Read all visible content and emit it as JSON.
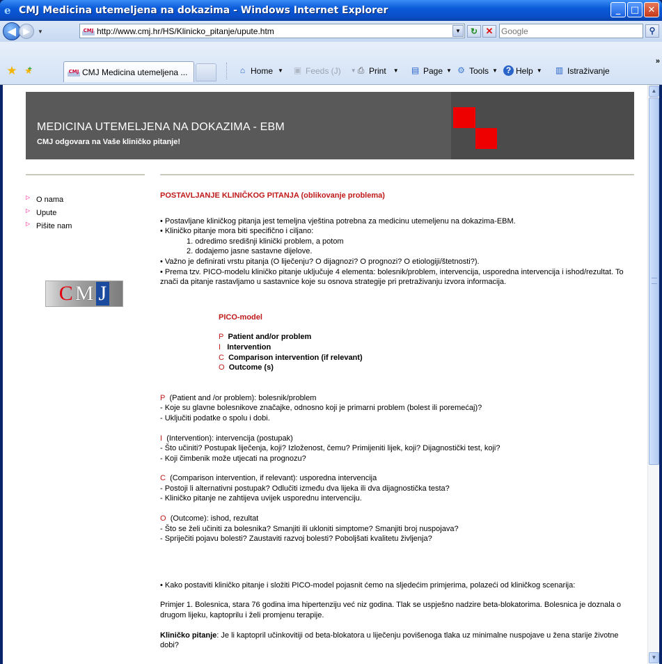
{
  "window": {
    "title": "CMJ Medicina utemeljena na dokazima - Windows Internet Explorer"
  },
  "addressbar": {
    "url": "http://www.cmj.hr/HS/Klinicko_pitanje/upute.htm",
    "search_placeholder": "Google",
    "favicon_text": "CMJ"
  },
  "tab": {
    "label": "CMJ Medicina utemeljena ..."
  },
  "commandbar": {
    "home": "Home",
    "feeds": "Feeds (J)",
    "print": "Print",
    "page": "Page",
    "tools": "Tools",
    "help": "Help",
    "research": "Istraživanje"
  },
  "banner": {
    "title": "MEDICINA UTEMELJENA NA DOKAZIMA - EBM",
    "subtitle": "CMJ odgovara na Vaše kliničko pitanje!"
  },
  "sidebar": {
    "items": [
      {
        "label": "O nama"
      },
      {
        "label": "Upute"
      },
      {
        "label": "Pišite nam"
      }
    ],
    "logo": {
      "c": "C",
      "m": "M",
      "j": "J"
    }
  },
  "content": {
    "heading": "POSTAVLJANJE KLINIČKOG PITANJA (oblikovanje problema)",
    "intro": [
      "• Postavljane kliničkog pitanja jest temeljna vještina potrebna za medicinu utemeljenu na dokazima-EBM.",
      "• Kliničko pitanje mora biti specifično i ciljano:",
      "1. odredimo središnji klinički problem, a potom",
      "2. dodajemo jasne sastavne dijelove.",
      "• Važno je definirati vrstu pitanja (O liječenju? O dijagnozi? O prognozi? O etiologiji/štetnosti?).",
      "• Prema tzv. PICO-modelu kliničko pitanje uključuje 4 elementa: bolesnik/problem, intervencija, usporedna intervencija i ishod/rezultat. To znači da pitanje rastavljamo u sastavnice koje su osnova strategije pri pretraživanju izvora informacija."
    ],
    "pico_title": "PICO-model",
    "pico": [
      {
        "letter": "P",
        "text": "Patient and/or problem"
      },
      {
        "letter": "I",
        "text": "Intervention"
      },
      {
        "letter": "C",
        "text": "Comparison intervention (if relevant)"
      },
      {
        "letter": "O",
        "text": "Outcome (s)"
      }
    ],
    "sections": [
      {
        "letter": "P",
        "head": "(Patient and /or problem): bolesnik/problem",
        "lines": [
          "- Koje su glavne bolesnikove značajke, odnosno koji je primarni problem (bolest ili poremećaj)?",
          "- Uključiti podatke o spolu i dobi."
        ]
      },
      {
        "letter": "I",
        "head": "(Intervention): intervencija (postupak)",
        "lines": [
          "- Što učiniti? Postupak liječenja, koji? Izloženost, čemu? Primijeniti lijek, koji? Dijagnostički test, koji?",
          "-  Koji čimbenik može utjecati na prognozu?"
        ]
      },
      {
        "letter": "C",
        "head": "(Comparison intervention, if relevant): usporedna intervencija",
        "lines": [
          "- Postoji li alternativni postupak? Odlučiti između dva lijeka ili dva dijagnostička testa?",
          "- Kliničko pitanje ne zahtijeva uvijek usporednu intervenciju."
        ]
      },
      {
        "letter": "O",
        "head": "(Outcome): ishod, rezultat",
        "lines": [
          "- Što se želi učiniti za bolesnika? Smanjiti ili ukloniti simptome? Smanjiti broj nuspojava?",
          "- Spriječiti pojavu bolesti? Zaustaviti razvoj bolesti? Poboljšati kvalitetu življenja?"
        ]
      }
    ],
    "example_intro": "• Kako postaviti kliničko pitanje i složiti PICO-model pojasnit ćemo na sljedećim primjerima, polazeći od kliničkog scenarija:",
    "example1": "Primjer 1. Bolesnica, stara 76 godina ima hipertenziju već niz godina. Tlak se uspješno nadzire beta-blokatorima. Bolesnica je doznala o drugom lijeku, kaptoprilu i želi promjenu terapije.",
    "clinical_label": "Kliničko pitanje",
    "clinical_text": ": Je li kaptopril učinkovitiji od beta-blokatora u liječenju povišenoga tlaka uz minimalne nuspojave u žena starije životne dobi?"
  },
  "colors": {
    "accent_red": "#c01818",
    "banner_gray": "#595959"
  }
}
